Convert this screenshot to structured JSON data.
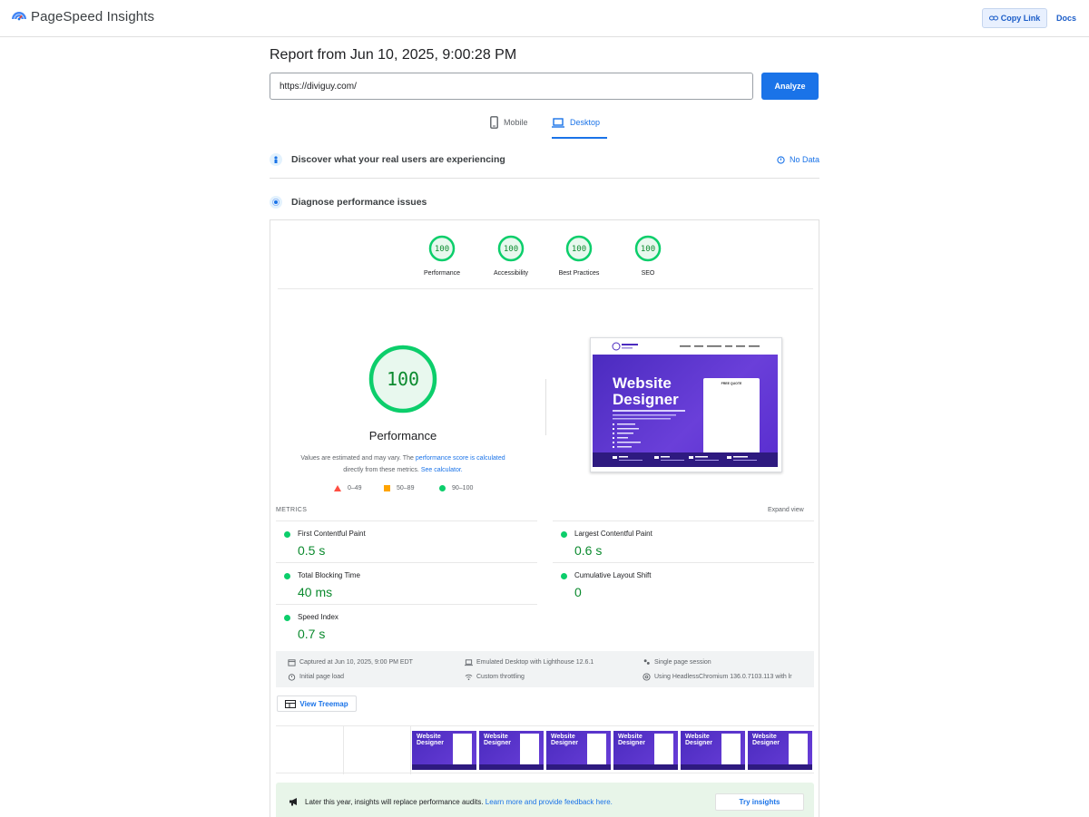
{
  "app": {
    "name": "PageSpeed Insights"
  },
  "header": {
    "copy_link": "Copy Link",
    "docs": "Docs"
  },
  "report": {
    "title": "Report from Jun 10, 2025, 9:00:28 PM",
    "url": "https://diviguy.com/",
    "analyze": "Analyze"
  },
  "tabs": [
    {
      "label": "Mobile",
      "icon": "phone-icon",
      "active": false
    },
    {
      "label": "Desktop",
      "icon": "laptop-icon",
      "active": true
    }
  ],
  "crux": {
    "title": "Discover what your real users are experiencing",
    "status": "No Data"
  },
  "diagnose": {
    "title": "Diagnose performance issues"
  },
  "categories": [
    {
      "score": "100",
      "label": "Performance"
    },
    {
      "score": "100",
      "label": "Accessibility"
    },
    {
      "score": "100",
      "label": "Best Practices"
    },
    {
      "score": "100",
      "label": "SEO"
    }
  ],
  "performance": {
    "score": "100",
    "title": "Performance",
    "note_prefix": "Values are estimated and may vary. The ",
    "note_link1": "performance score is calculated",
    "note_middle": " directly from these metrics. ",
    "note_link2": "See calculator."
  },
  "legend": [
    {
      "range": "0–49",
      "color": "#ff4e42",
      "shape": "triangle"
    },
    {
      "range": "50–89",
      "color": "#ffa400",
      "shape": "square"
    },
    {
      "range": "90–100",
      "color": "#0cce6b",
      "shape": "circle"
    }
  ],
  "screenshot": {
    "headline_line1": "Website",
    "headline_line2": "Designer",
    "form_title": "FREE QUOTE"
  },
  "metrics": {
    "label": "METRICS",
    "expand": "Expand view",
    "items": [
      {
        "name": "First Contentful Paint",
        "value": "0.5 s"
      },
      {
        "name": "Largest Contentful Paint",
        "value": "0.6 s"
      },
      {
        "name": "Total Blocking Time",
        "value": "40 ms"
      },
      {
        "name": "Cumulative Layout Shift",
        "value": "0"
      },
      {
        "name": "Speed Index",
        "value": "0.7 s"
      }
    ]
  },
  "info": {
    "captured": "Captured at Jun 10, 2025, 9:00 PM EDT",
    "load": "Initial page load",
    "emulated": "Emulated Desktop with Lighthouse 12.6.1",
    "throttling": "Custom throttling",
    "session": "Single page session",
    "browser": "Using HeadlessChromium 136.0.7103.113 with lr"
  },
  "treemap": {
    "label": "View Treemap"
  },
  "filmstrip": {
    "frame_line1": "Website",
    "frame_line2": "Designer"
  },
  "insights": {
    "text": "Later this year, insights will replace performance audits.",
    "link": "Learn more and provide feedback here.",
    "button": "Try insights"
  },
  "colors": {
    "accent": "#1a73e8",
    "pass": "#0cce6b",
    "pass_text": "#0b8a2e"
  }
}
